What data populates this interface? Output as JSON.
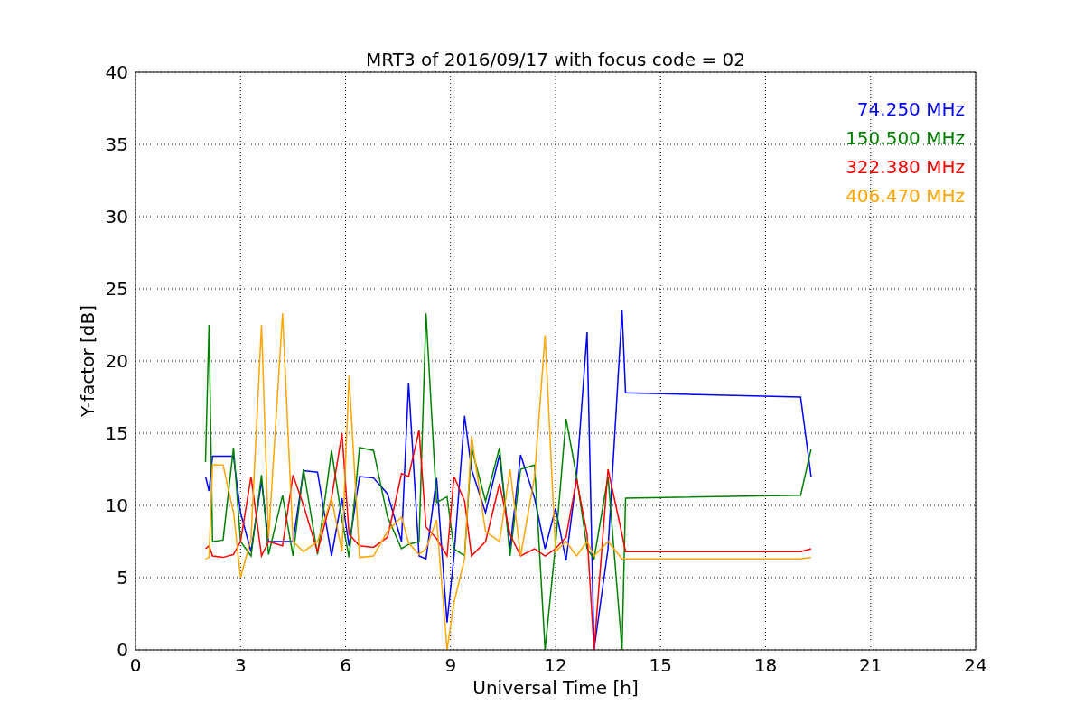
{
  "figure": {
    "chart_data": {
      "type": "line",
      "title": "MRT3 of 2016/09/17 with focus code = 02",
      "xlabel": "Universal Time [h]",
      "ylabel": "Y-factor [dB]",
      "x": [
        2.0,
        2.1,
        2.2,
        2.5,
        2.8,
        3.0,
        3.3,
        3.6,
        3.8,
        4.2,
        4.5,
        4.8,
        5.2,
        5.6,
        5.9,
        6.1,
        6.4,
        6.8,
        7.2,
        7.6,
        7.8,
        8.1,
        8.3,
        8.6,
        8.9,
        9.1,
        9.4,
        9.6,
        10.0,
        10.4,
        10.7,
        11.0,
        11.4,
        11.7,
        12.0,
        12.3,
        12.6,
        12.9,
        13.1,
        13.5,
        13.9,
        14.0,
        19.0,
        19.3
      ],
      "series": [
        {
          "name": "74.250 MHz",
          "color": "#0000ff",
          "values": [
            12,
            11,
            13.4,
            13.4,
            13.4,
            9.5,
            6.8,
            11.7,
            7.5,
            7.5,
            7.5,
            12.4,
            12.3,
            6.5,
            10.5,
            7.2,
            12,
            11.9,
            10.8,
            7.5,
            18.5,
            6.5,
            6.3,
            11.9,
            1.9,
            6.5,
            16.2,
            12.5,
            9.5,
            13.5,
            7,
            13.5,
            10.5,
            7,
            9.8,
            6.2,
            12,
            22,
            0,
            7,
            23.5,
            17.8,
            17.5,
            12
          ]
        },
        {
          "name": "150.500 MHz",
          "color": "#008000",
          "values": [
            13,
            22.5,
            7.5,
            7.6,
            14,
            7.5,
            6.5,
            12.1,
            6.6,
            10.7,
            6.5,
            12.5,
            6.6,
            13.8,
            9,
            6.4,
            14,
            13.8,
            9.2,
            7,
            7.3,
            7.5,
            23.3,
            10.2,
            10.6,
            7,
            6.5,
            14,
            10.3,
            14,
            6.5,
            12.5,
            12.8,
            0,
            7.3,
            16,
            12,
            7,
            6.3,
            12,
            0,
            10.5,
            10.7,
            13.9
          ]
        },
        {
          "name": "322.380 MHz",
          "color": "#ff0000",
          "values": [
            7,
            7.2,
            6.5,
            6.4,
            6.6,
            7.5,
            12,
            6.5,
            7.5,
            7.2,
            12.1,
            10,
            6.8,
            10.5,
            15,
            8,
            7.2,
            7.1,
            7.8,
            12.2,
            12,
            15.2,
            8.5,
            7.7,
            6.5,
            12,
            10.3,
            6.5,
            7.5,
            11.5,
            8,
            6.5,
            7,
            6.5,
            7,
            7.8,
            11.8,
            8,
            0,
            12.5,
            8,
            6.8,
            6.8,
            7
          ]
        },
        {
          "name": "406.470 MHz",
          "color": "#ffa500",
          "values": [
            6.3,
            6.4,
            12.8,
            12.8,
            9.5,
            5,
            7.7,
            22.5,
            7.7,
            23.3,
            7.5,
            6.8,
            7.5,
            10.5,
            6.8,
            19,
            6.4,
            6.5,
            8.2,
            9.2,
            7.4,
            6.6,
            7,
            9,
            0,
            3.3,
            6.3,
            14.8,
            8.2,
            7.5,
            12.5,
            6.5,
            12,
            21.8,
            6.8,
            7.5,
            6.5,
            7.5,
            6.5,
            7.5,
            6.3,
            6.3,
            6.3,
            6.4
          ]
        }
      ],
      "grid": true,
      "xlim": [
        0,
        24
      ],
      "ylim": [
        0,
        40
      ],
      "xticks": [
        0,
        3,
        6,
        9,
        12,
        15,
        18,
        21,
        24
      ],
      "yticks": [
        0,
        5,
        10,
        15,
        20,
        25,
        30,
        35,
        40
      ]
    }
  }
}
